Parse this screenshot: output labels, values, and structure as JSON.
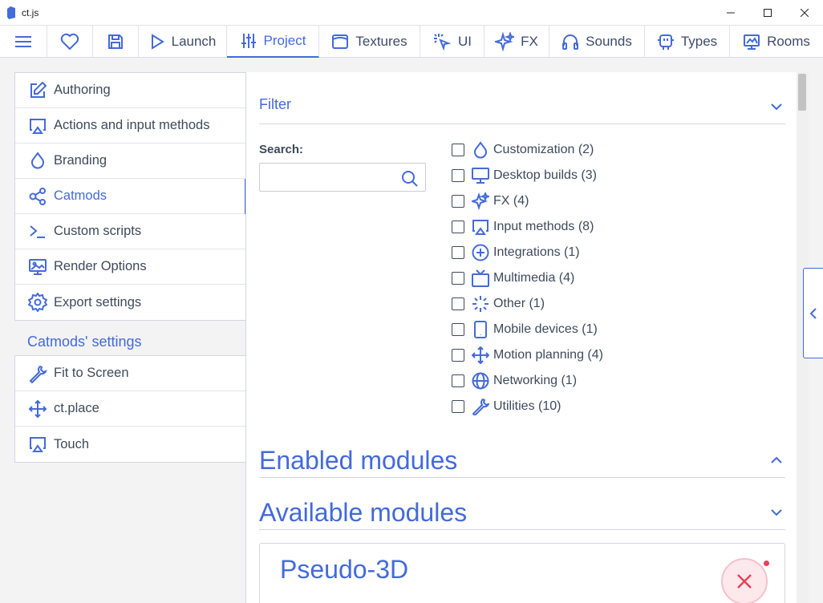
{
  "window": {
    "title": "ct.js"
  },
  "tabs": [
    {
      "label": "",
      "icon": "menu-icon"
    },
    {
      "label": "",
      "icon": "heart-icon"
    },
    {
      "label": "",
      "icon": "save-icon"
    },
    {
      "label": "Launch",
      "icon": "play-icon"
    },
    {
      "label": "Project",
      "icon": "sliders-icon",
      "active": true
    },
    {
      "label": "Textures",
      "icon": "texture-icon"
    },
    {
      "label": "UI",
      "icon": "cursor-icon"
    },
    {
      "label": "FX",
      "icon": "sparkles-icon"
    },
    {
      "label": "Sounds",
      "icon": "headphones-icon"
    },
    {
      "label": "Types",
      "icon": "robot-icon"
    },
    {
      "label": "Rooms",
      "icon": "room-icon"
    }
  ],
  "sidebar": {
    "items": [
      {
        "label": "Authoring",
        "icon": "edit-icon"
      },
      {
        "label": "Actions and input methods",
        "icon": "airplay-icon"
      },
      {
        "label": "Branding",
        "icon": "droplet-icon"
      },
      {
        "label": "Catmods",
        "icon": "share-nodes-icon",
        "active": true
      },
      {
        "label": "Custom scripts",
        "icon": "terminal-icon"
      },
      {
        "label": "Render Options",
        "icon": "image-icon"
      },
      {
        "label": "Export settings",
        "icon": "gear-icon"
      }
    ],
    "section_title": "Catmods' settings",
    "catmod_items": [
      {
        "label": "Fit to Screen",
        "icon": "wrench-icon"
      },
      {
        "label": "ct.place",
        "icon": "move-icon"
      },
      {
        "label": "Touch",
        "icon": "airplay-icon"
      }
    ]
  },
  "filter": {
    "title": "Filter",
    "search_label": "Search:",
    "search_value": "",
    "categories": [
      {
        "label": "Customization (2)",
        "icon": "droplet-icon",
        "checked": false
      },
      {
        "label": "Desktop builds (3)",
        "icon": "monitor-icon",
        "checked": false
      },
      {
        "label": "FX (4)",
        "icon": "sparkles-icon",
        "checked": false
      },
      {
        "label": "Input methods (8)",
        "icon": "airplay-icon",
        "checked": false
      },
      {
        "label": "Integrations (1)",
        "icon": "plus-circle-icon",
        "checked": false
      },
      {
        "label": "Multimedia (4)",
        "icon": "tv-icon",
        "checked": false
      },
      {
        "label": "Other (1)",
        "icon": "loader-icon",
        "checked": false
      },
      {
        "label": "Mobile devices (1)",
        "icon": "smartphone-icon",
        "checked": false
      },
      {
        "label": "Motion planning (4)",
        "icon": "move-icon",
        "checked": false
      },
      {
        "label": "Networking (1)",
        "icon": "globe-icon",
        "checked": false
      },
      {
        "label": "Utilities (10)",
        "icon": "wrench-icon",
        "checked": false
      }
    ]
  },
  "sections": {
    "enabled_title": "Enabled modules",
    "available_title": "Available modules"
  },
  "module_card": {
    "name": "Pseudo-3D"
  },
  "colors": {
    "accent": "#446adb",
    "danger": "#e8405a",
    "background": "#f3f3f3"
  }
}
